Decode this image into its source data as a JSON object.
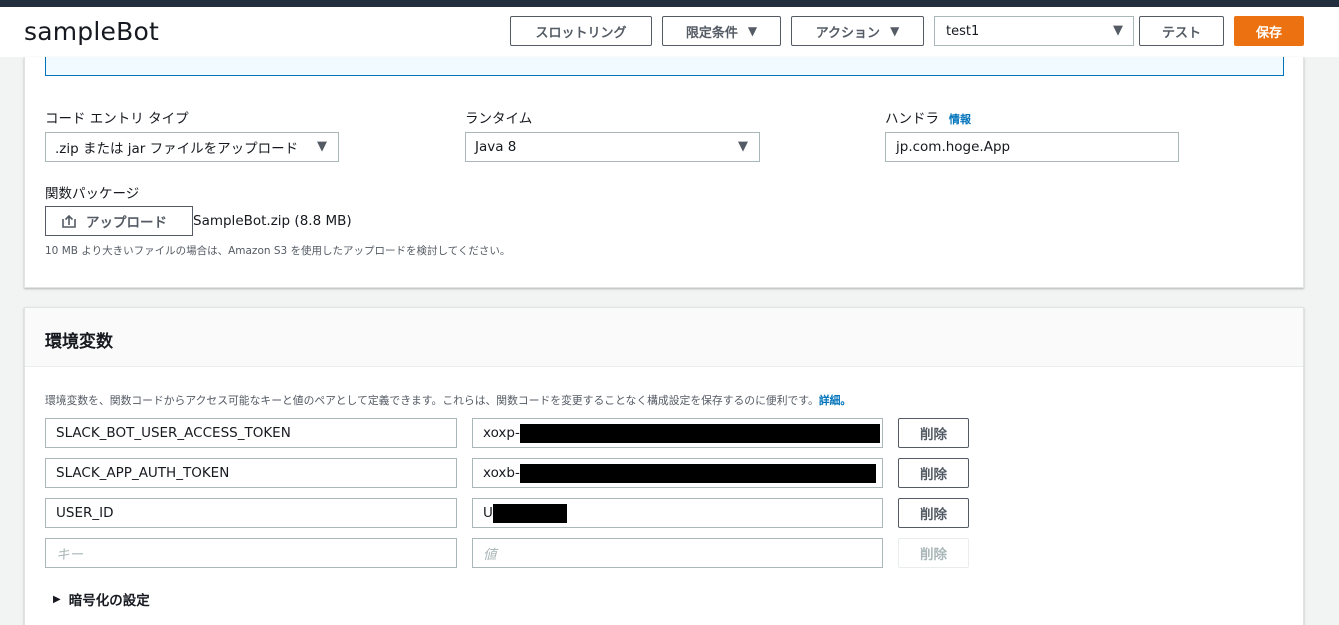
{
  "header": {
    "title": "sampleBot",
    "throttling_label": "スロットリング",
    "qualifiers_label": "限定条件",
    "actions_label": "アクション",
    "test_event_value": "test1",
    "test_label": "テスト",
    "save_label": "保存"
  },
  "code": {
    "entry_type_label": "コード エントリ タイプ",
    "entry_type_value": ".zip または jar ファイルをアップロード",
    "runtime_label": "ランタイム",
    "runtime_value": "Java 8",
    "handler_label": "ハンドラ",
    "handler_info": "情報",
    "handler_value": "jp.com.hoge.App",
    "package_label": "関数パッケージ",
    "upload_label": "アップロード",
    "file_name": "SampleBot.zip (8.8 MB)",
    "hint": "10 MB より大きいファイルの場合は、Amazon S3 を使用したアップロードを検討してください。"
  },
  "env": {
    "title": "環境変数",
    "description": "環境変数を、関数コードからアクセス可能なキーと値のペアとして定義できます。これらは、関数コードを変更することなく構成設定を保存するのに便利です。",
    "more_link": "詳細。",
    "rows": [
      {
        "key": "SLACK_BOT_USER_ACCESS_TOKEN",
        "value_prefix": "xoxp-",
        "delete_label": "削除"
      },
      {
        "key": "SLACK_APP_AUTH_TOKEN",
        "value_prefix": "xoxb-",
        "delete_label": "削除"
      },
      {
        "key": "USER_ID",
        "value_prefix": "U",
        "delete_label": "削除"
      }
    ],
    "new_row": {
      "key_placeholder": "キー",
      "value_placeholder": "値",
      "delete_label": "削除"
    },
    "encryption_label": "暗号化の設定"
  },
  "colors": {
    "accent": "#0073bb",
    "save": "#ec7211",
    "topbar": "#232f3e"
  }
}
